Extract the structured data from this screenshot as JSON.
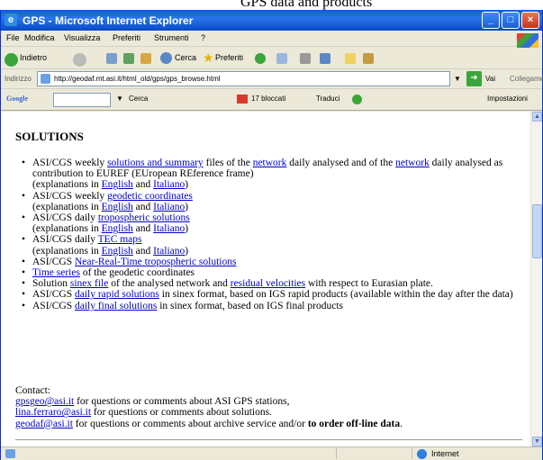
{
  "top_caption": "GPS data and products",
  "window": {
    "title": "GPS - Microsoft Internet Explorer"
  },
  "menu": [
    "File",
    "Modifica",
    "Visualizza",
    "Preferiti",
    "Strumenti",
    "?"
  ],
  "toolbar": {
    "back": "Indietro",
    "search": "Cerca",
    "favorites": "Preferiti"
  },
  "address": {
    "label": "Indirizzo",
    "url": "http://geodaf.mt.asi.it/html_old/gps/gps_browse.html",
    "go": "Vai",
    "links": "Collegamenti"
  },
  "googlebar": {
    "logo": "Google",
    "search": "Cerca",
    "blocked": "17 bloccati",
    "translate": "Traduci",
    "settings": "Impostazioni"
  },
  "page": {
    "heading": "SOLUTIONS",
    "items": [
      {
        "pre": "ASI/CGS weekly ",
        "l1": "solutions and summary",
        "mid": " files of the ",
        "l2": "network",
        "mid2": " daily analysed and of the ",
        "l3": "network",
        "post": " daily analysed as contribution to EUREF (EUropean REference frame)",
        "ex_pre": "(explanations in ",
        "ex_en": "English",
        "ex_and": " and ",
        "ex_it": "Italiano",
        "ex_post": ")"
      },
      {
        "pre": "ASI/CGS weekly ",
        "link": "geodetic coordinates",
        "post": "",
        "ex_pre": "(explanations in ",
        "ex_en": "English",
        "ex_and": " and ",
        "ex_it": "Italiano",
        "ex_post": ")"
      },
      {
        "pre": "ASI/CGS daily ",
        "link": "tropospheric solutions",
        "post": "",
        "ex_pre": "(explanations in ",
        "ex_en": "English",
        "ex_and": " and ",
        "ex_it": "Italiano",
        "ex_post": ")"
      },
      {
        "pre": "ASI/CGS daily ",
        "link": "TEC maps",
        "post": "",
        "ex_pre": "(explanations in ",
        "ex_en": "English",
        "ex_and": " and ",
        "ex_it": "Italiano",
        "ex_post": ")"
      },
      {
        "pre": "ASI/CGS ",
        "link": "Near-Real-Time tropospheric solutions",
        "post": ""
      },
      {
        "pre": "",
        "link": "Time series",
        "post": " of the geodetic coordinates"
      },
      {
        "pre": "Solution ",
        "link": "sinex file",
        "mid": " of the analysed network and ",
        "link2": "residual velocities",
        "post": " with respect to Eurasian plate."
      },
      {
        "pre": "ASI/CGS ",
        "link": "daily rapid solutions",
        "post": " in sinex format, based on IGS rapid products (available within the day after the data)"
      },
      {
        "pre": "ASI/CGS ",
        "link": "daily final solutions",
        "post": " in sinex format, based on IGS final products"
      }
    ],
    "contact": {
      "label": "Contact:",
      "e1": "gpsgeo@asi.it",
      "t1": " for questions or comments about ASI GPS stations,",
      "e2": "lina.ferraro@asi.it",
      "t2": " for questions or comments about solutions.",
      "e3": "geodaf@asi.it",
      "t3": " for questions or comments about archive service and/or ",
      "t3b": "to order off-line data",
      "t3c": "."
    }
  },
  "status": {
    "zone": "Internet"
  }
}
